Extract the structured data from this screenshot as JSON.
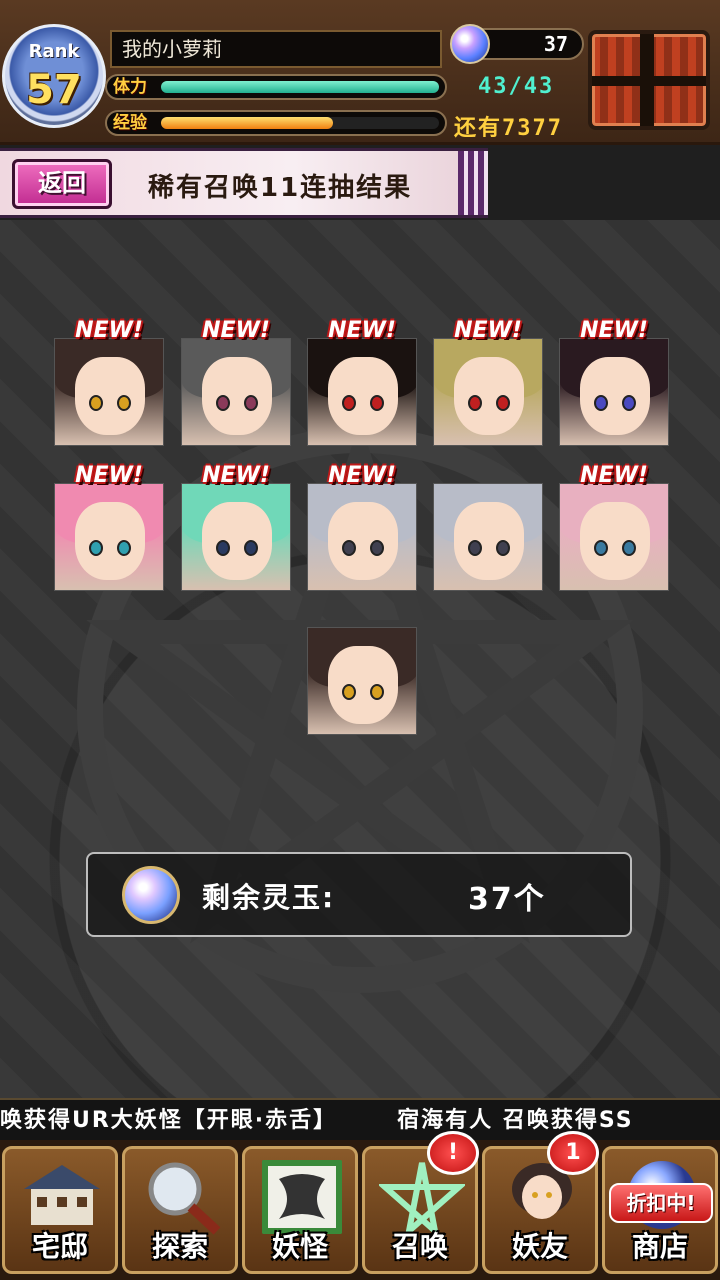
{
  "player": {
    "rank_label": "Rank",
    "rank": "57",
    "name": "我的小萝莉",
    "stamina_label": "体力",
    "stamina_text": "43/43",
    "stamina_fraction": 1.0,
    "exp_label": "经验",
    "exp_text": "还有7377",
    "exp_fraction": 0.62,
    "gems": "37"
  },
  "header": {
    "back_label": "返回",
    "title": "稀有召唤11连抽结果"
  },
  "results": {
    "new_label": "NEW!",
    "cards": [
      {
        "is_new": true,
        "hair": "#3a2a26",
        "eye": "#d8a020"
      },
      {
        "is_new": true,
        "hair": "#5a5a5a",
        "eye": "#8a3a5a"
      },
      {
        "is_new": true,
        "hair": "#1a1210",
        "eye": "#c02020"
      },
      {
        "is_new": true,
        "hair": "#b8a860",
        "eye": "#c02020"
      },
      {
        "is_new": true,
        "hair": "#2a1a20",
        "eye": "#4a4ac0"
      },
      {
        "is_new": true,
        "hair": "#f08ab0",
        "eye": "#30a0b0"
      },
      {
        "is_new": true,
        "hair": "#70d8b8",
        "eye": "#2a3a60"
      },
      {
        "is_new": true,
        "hair": "#b8bcc8",
        "eye": "#404050"
      },
      {
        "is_new": false,
        "hair": "#b8bcc8",
        "eye": "#404050"
      },
      {
        "is_new": true,
        "hair": "#e8b0c0",
        "eye": "#3a7aa0"
      },
      {
        "is_new": false,
        "hair": "#3a2a26",
        "eye": "#d8a020"
      }
    ]
  },
  "remaining": {
    "label": "剩余灵玉:",
    "value": "37个"
  },
  "ticker": {
    "messages": [
      "唤获得UR大妖怪【开眼·赤舌】",
      "宿海有人 召唤获得SS"
    ]
  },
  "nav": {
    "items": [
      {
        "label": "宅邸",
        "icon": "mansion-icon",
        "badge": ""
      },
      {
        "label": "探索",
        "icon": "magnifier-icon",
        "badge": ""
      },
      {
        "label": "妖怪",
        "icon": "scroll-icon",
        "badge": ""
      },
      {
        "label": "召唤",
        "icon": "pentagram-icon",
        "badge": "!"
      },
      {
        "label": "妖友",
        "icon": "friend-icon",
        "badge": "1"
      },
      {
        "label": "商店",
        "icon": "orb-icon",
        "badge": "",
        "tag": "折扣中!"
      }
    ]
  },
  "colors": {
    "accent_pink": "#c02a90",
    "stamina": "#22b090",
    "exp": "#f08010"
  }
}
